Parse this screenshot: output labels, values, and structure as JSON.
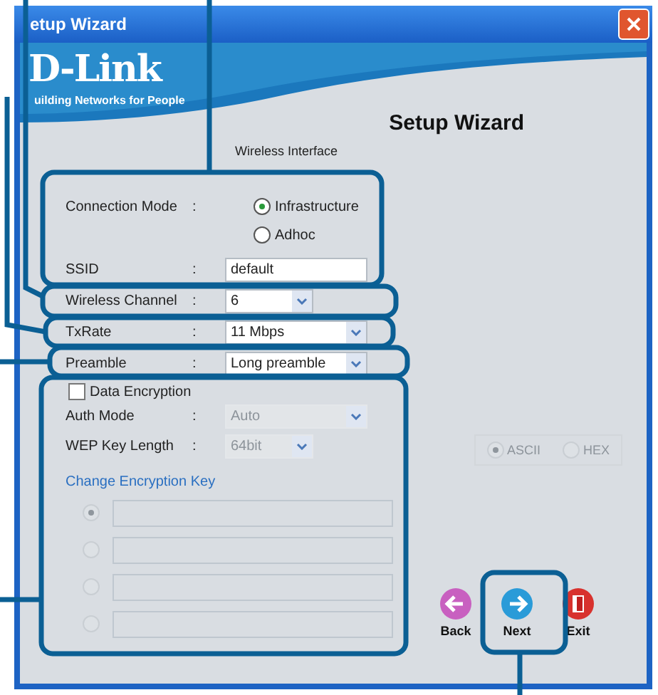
{
  "window": {
    "title": "etup Wizard"
  },
  "brand": {
    "logo": "D-Link",
    "tagline": "uilding Networks for People"
  },
  "heading": "Setup Wizard",
  "section": "Wireless Interface",
  "connection_mode": {
    "label": "Connection Mode",
    "separator": ":",
    "options": [
      {
        "label": "Infrastructure",
        "selected": true
      },
      {
        "label": "Adhoc",
        "selected": false
      }
    ]
  },
  "settings": [
    {
      "kind": "text",
      "label": "SSID",
      "separator": ":",
      "value": "default"
    },
    {
      "kind": "narrow_select",
      "label": "Wireless Channel",
      "separator": ":",
      "value": "6"
    },
    {
      "kind": "select",
      "label": "TxRate",
      "separator": ":",
      "value": "11 Mbps"
    },
    {
      "kind": "select",
      "label": "Preamble",
      "separator": ":",
      "value": "Long preamble"
    }
  ],
  "encryption": {
    "label": "Data Encryption",
    "checked": false,
    "fields": [
      {
        "kind": "select",
        "label": "Auth Mode",
        "separator": ":",
        "value": "Auto",
        "disabled": true
      },
      {
        "kind": "narrow_select",
        "label": "WEP Key Length",
        "separator": ":",
        "value": "64bit",
        "disabled": true
      }
    ],
    "key_format": [
      {
        "label": "ASCII",
        "selected": true,
        "disabled": true
      },
      {
        "label": "HEX",
        "selected": false,
        "disabled": true
      }
    ],
    "change_key_label": "Change Encryption Key",
    "keys": [
      {
        "selected": true,
        "disabled": true
      },
      {
        "selected": false,
        "disabled": true
      },
      {
        "selected": false,
        "disabled": true
      },
      {
        "selected": false,
        "disabled": true
      }
    ]
  },
  "buttons": [
    {
      "kind": "back",
      "label": "Back"
    },
    {
      "kind": "next",
      "label": "Next"
    },
    {
      "kind": "exit",
      "label": "Exit"
    }
  ]
}
